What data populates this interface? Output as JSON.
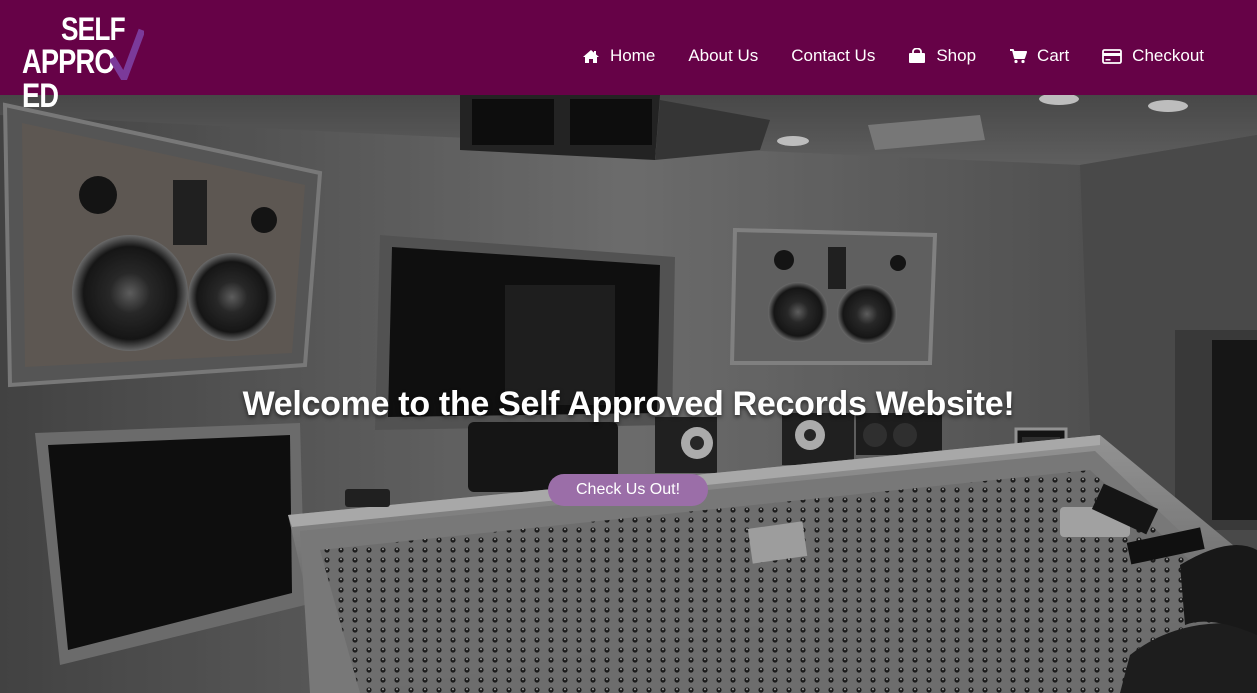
{
  "brand": {
    "line1": "SELF",
    "line2": "APPRO",
    "line2_end": "ED"
  },
  "colors": {
    "header": "#660247",
    "accent": "#9b6ea8",
    "checkmark": "#7b3a9a"
  },
  "nav": [
    {
      "label": "Home",
      "icon": "home-icon"
    },
    {
      "label": "About Us",
      "icon": ""
    },
    {
      "label": "Contact Us",
      "icon": ""
    },
    {
      "label": "Shop",
      "icon": "shopping-bag-icon"
    },
    {
      "label": "Cart",
      "icon": "cart-icon"
    },
    {
      "label": "Checkout",
      "icon": "credit-card-icon"
    }
  ],
  "hero": {
    "title": "Welcome to the Self Approved Records Website!",
    "button": "Check Us Out!"
  }
}
